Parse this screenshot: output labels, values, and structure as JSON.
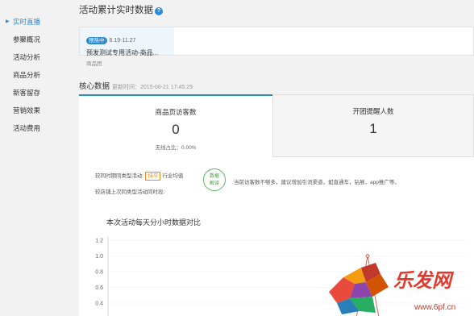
{
  "sidebar": {
    "items": [
      {
        "label": "实时直播",
        "active": true
      },
      {
        "label": "参聚概况"
      },
      {
        "label": "活动分析"
      },
      {
        "label": "商品分析"
      },
      {
        "label": "新客留存"
      },
      {
        "label": "营销效果"
      },
      {
        "label": "活动费用"
      }
    ]
  },
  "header": {
    "title": "活动累计实时数据",
    "help_icon": "?"
  },
  "activity": {
    "badge": "预热中",
    "date": "8.19-11.27",
    "name": "预发测试专用活动-商品...",
    "type": "商品团"
  },
  "core": {
    "title": "核心数据",
    "update_time": "更新时间：2015-08-21 17:45:29",
    "tabs": [
      {
        "label": "商品页访客数",
        "value": "0",
        "sub": "无线占比：0.00%"
      },
      {
        "label": "开团提醒人数",
        "value": "1"
      }
    ],
    "compare": {
      "line1_prefix": "较同时期同类型活动:",
      "line1_tag": "持平",
      "line1_suffix": "行业均值",
      "line2": "较店铺上次同类型活动同时段:"
    },
    "advice": {
      "circle_line1": "数据",
      "circle_line2": "解读",
      "text": "当前访客数不够多，建议增加引流渠道，如直通车，钻展，app推广等。"
    }
  },
  "chart_data": {
    "type": "line",
    "title": "本次活动每天分小时数据对比",
    "ylim": [
      0,
      1.2
    ],
    "yticks": [
      "1.2",
      "1.0",
      "0.8",
      "0.6",
      "0.4"
    ],
    "series": [
      {
        "values": [
          0,
          0,
          0,
          0,
          0,
          0,
          0,
          0,
          0,
          0,
          0,
          0,
          0,
          0,
          0,
          0,
          0,
          0,
          1.0,
          0
        ]
      }
    ]
  },
  "watermark": {
    "brand": "乐发网",
    "url": "www.6pf.cn"
  },
  "colors": {
    "accent": "#2a8ad4",
    "badge": "#2a8ad4",
    "tag": "#f08a1c",
    "advice": "#5cb85c",
    "line": "#d9534f"
  }
}
